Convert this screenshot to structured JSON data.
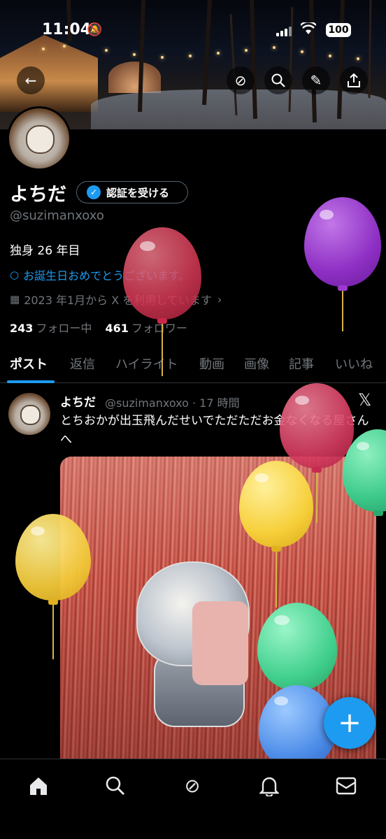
{
  "status_bar": {
    "time": "11:04",
    "battery": "100"
  },
  "header": {
    "back_label": "←",
    "grok_label": "⊘",
    "search_label": "⌕",
    "edit_label": "✎",
    "share_label": "⇪"
  },
  "profile": {
    "display_name": "よちだ",
    "verify_label": "認証を受ける",
    "handle": "@suzimanxoxo",
    "bio": "独身 26 年目",
    "birthday_text": "お誕生日おめでとうございます。",
    "joined_text": "2023 年1月から X を利用しています",
    "following_count": "243",
    "following_label": "フォロー中",
    "followers_count": "461",
    "followers_label": "フォロワー"
  },
  "tabs": [
    "ポスト",
    "返信",
    "ハイライト",
    "動画",
    "画像",
    "記事",
    "いいね"
  ],
  "post": {
    "name": "よちだ",
    "meta": "@suzimanxoxo · 17 時間",
    "text": "とちおかが出玉飛んだせいでただただお金なくなる屋さんへ"
  },
  "fab_label": "+",
  "bottom_nav": [
    {
      "icon": "home-icon",
      "glyph": "⌂"
    },
    {
      "icon": "search-icon",
      "glyph": "⌕"
    },
    {
      "icon": "grok-icon",
      "glyph": "⊘"
    },
    {
      "icon": "bell-icon",
      "glyph": "♫"
    },
    {
      "icon": "mail-icon",
      "glyph": "✉"
    }
  ],
  "colors": {
    "accent": "#1d9bf0",
    "background": "#000000",
    "muted_text": "#71767b"
  }
}
